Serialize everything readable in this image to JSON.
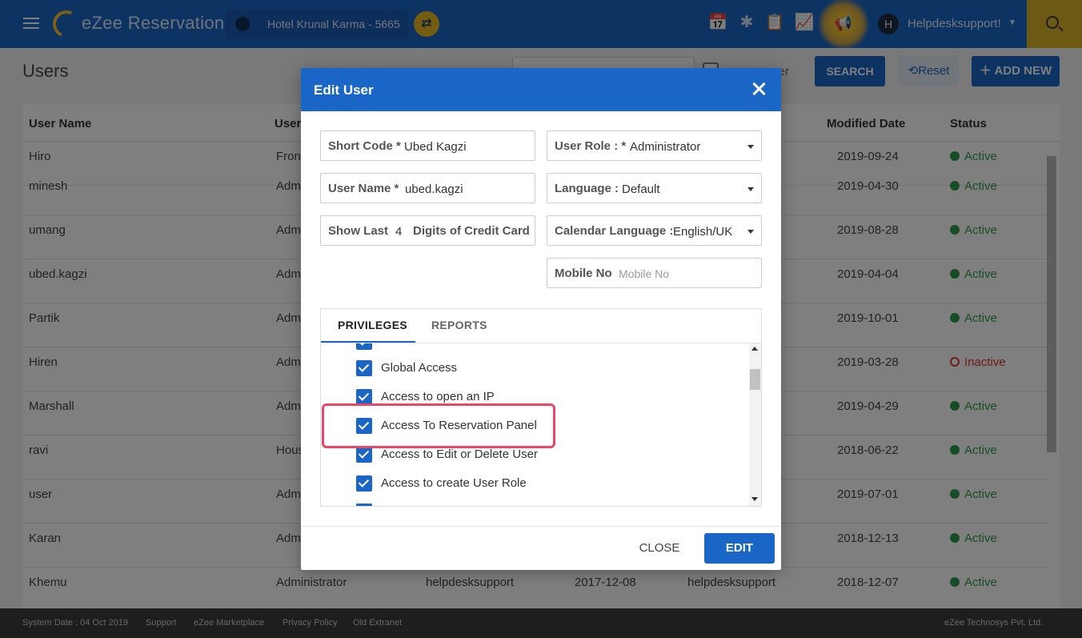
{
  "topbar": {
    "app_name": "eZee Reservation",
    "hotel": "Hotel Krunal Karma -  5665",
    "user_initial": "H",
    "username": "Helpdesksupport!"
  },
  "page": {
    "title": "Users",
    "active_user_label": "ser",
    "search_label": "SEARCH",
    "reset_label": "Reset",
    "add_new_label": "ADD NEW"
  },
  "table": {
    "headers": {
      "user_name": "User Name",
      "user_role": "User",
      "modified_date": "Modified Date",
      "status": "Status"
    },
    "rows": [
      {
        "name": "Hiro",
        "role": "Fron",
        "modified": "2019-09-24",
        "status": "Active"
      },
      {
        "name": "minesh",
        "role": "Adm",
        "modified": "2019-04-30",
        "status": "Active"
      },
      {
        "name": "umang",
        "role": "Adm",
        "modified": "2019-08-28",
        "status": "Active"
      },
      {
        "name": "ubed.kagzi",
        "role": "Adm",
        "modified": "2019-04-04",
        "status": "Active"
      },
      {
        "name": "Partik",
        "role": "Adm",
        "modified": "2019-10-01",
        "status": "Active"
      },
      {
        "name": "Hiren",
        "role": "Adm",
        "modified": "2019-03-28",
        "status": "Inactive"
      },
      {
        "name": "Marshall",
        "role": "Adm",
        "modified": "2019-04-29",
        "status": "Active"
      },
      {
        "name": "ravi",
        "role": "Hous",
        "modified": "2018-06-22",
        "status": "Active"
      },
      {
        "name": "user",
        "role": "Adm",
        "modified": "2019-07-01",
        "status": "Active"
      },
      {
        "name": "Karan",
        "role": "Adm",
        "modified": "2018-12-13",
        "status": "Active"
      },
      {
        "name": "Khemu",
        "role": "Administrator",
        "created_by": "helpdesksupport",
        "created": "2017-12-08",
        "modified_by": "helpdesksupport",
        "modified": "2018-12-07",
        "status": "Active"
      }
    ]
  },
  "footer": {
    "system_date": "System Date : 04 Oct 2019",
    "support": "Support",
    "marketplace": "eZee Marketplace",
    "privacy": "Privacy Policy",
    "old_extranet": "Old Extranet",
    "copyright": "eZee Technosys Pvt. Ltd."
  },
  "modal": {
    "title": "Edit User",
    "short_code_label": "Short Code *",
    "short_code_value": "Ubed Kagzi",
    "user_name_label": "User Name *",
    "user_name_value": "ubed.kagzi",
    "show_last_label": "Show Last",
    "show_last_value": "4",
    "show_last_suffix": "Digits of Credit Card",
    "user_role_label": "User Role : *",
    "user_role_value": "Administrator",
    "language_label": "Language :",
    "language_value": "Default",
    "calendar_language_label": "Calendar Language :",
    "calendar_language_value": "English/UK",
    "mobile_label": "Mobile No",
    "mobile_placeholder": "Mobile No",
    "tabs": [
      "PRIVILEGES",
      "REPORTS"
    ],
    "privileges": [
      "Global Access",
      "Access to open an IP",
      "Access To Reservation Panel",
      "Access to Edit or Delete User",
      "Access to create User Role"
    ],
    "close_label": "CLOSE",
    "edit_label": "EDIT"
  },
  "colors": {
    "primary": "#1a66c7",
    "accent": "#e8b821",
    "active": "#2e9b4a",
    "inactive": "#d9362f",
    "highlight": "#e8476a"
  }
}
